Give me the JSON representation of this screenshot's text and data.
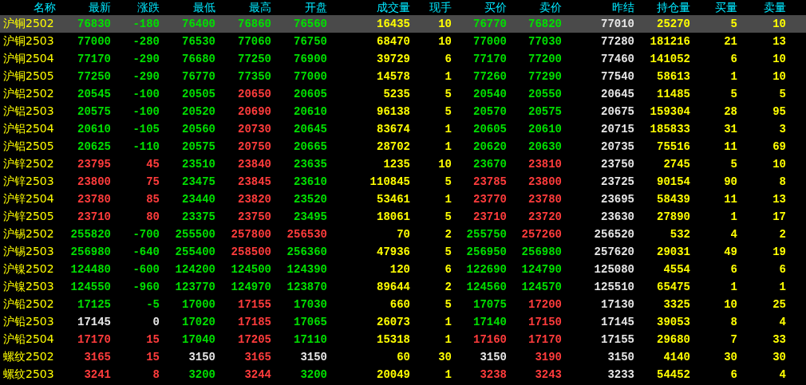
{
  "table": {
    "columns": [
      {
        "label": "名称",
        "kind": "name"
      },
      {
        "label": "最新",
        "kind": "price"
      },
      {
        "label": "涨跌",
        "kind": "price"
      },
      {
        "label": "最低",
        "kind": "price"
      },
      {
        "label": "最高",
        "kind": "price"
      },
      {
        "label": "开盘",
        "kind": "price"
      },
      {
        "label": "成交量",
        "kind": "volume"
      },
      {
        "label": "现手",
        "kind": "volume"
      },
      {
        "label": "买价",
        "kind": "price"
      },
      {
        "label": "卖价",
        "kind": "price"
      },
      {
        "label": "昨结",
        "kind": "reference"
      },
      {
        "label": "持仓量",
        "kind": "volume"
      },
      {
        "label": "买量",
        "kind": "volume"
      },
      {
        "label": "卖量",
        "kind": "volume"
      }
    ],
    "rows": [
      {
        "selected": true,
        "cells": [
          {
            "text": "沪铜2502"
          },
          {
            "text": "76830",
            "color": "#00e000"
          },
          {
            "text": "-180",
            "color": "#00e000"
          },
          {
            "text": "76400",
            "color": "#00e000"
          },
          {
            "text": "76860",
            "color": "#00e000"
          },
          {
            "text": "76560",
            "color": "#00e000"
          },
          {
            "text": "16435"
          },
          {
            "text": "10"
          },
          {
            "text": "76770",
            "color": "#00e000"
          },
          {
            "text": "76820",
            "color": "#00e000"
          },
          {
            "text": "77010"
          },
          {
            "text": "25270"
          },
          {
            "text": "5"
          },
          {
            "text": "10"
          }
        ]
      },
      {
        "selected": false,
        "cells": [
          {
            "text": "沪铜2503"
          },
          {
            "text": "77000",
            "color": "#00e000"
          },
          {
            "text": "-280",
            "color": "#00e000"
          },
          {
            "text": "76530",
            "color": "#00e000"
          },
          {
            "text": "77060",
            "color": "#00e000"
          },
          {
            "text": "76750",
            "color": "#00e000"
          },
          {
            "text": "68470"
          },
          {
            "text": "10"
          },
          {
            "text": "77000",
            "color": "#00e000"
          },
          {
            "text": "77030",
            "color": "#00e000"
          },
          {
            "text": "77280"
          },
          {
            "text": "181216"
          },
          {
            "text": "21"
          },
          {
            "text": "13"
          }
        ]
      },
      {
        "selected": false,
        "cells": [
          {
            "text": "沪铜2504"
          },
          {
            "text": "77170",
            "color": "#00e000"
          },
          {
            "text": "-290",
            "color": "#00e000"
          },
          {
            "text": "76680",
            "color": "#00e000"
          },
          {
            "text": "77250",
            "color": "#00e000"
          },
          {
            "text": "76900",
            "color": "#00e000"
          },
          {
            "text": "39729"
          },
          {
            "text": "6"
          },
          {
            "text": "77170",
            "color": "#00e000"
          },
          {
            "text": "77200",
            "color": "#00e000"
          },
          {
            "text": "77460"
          },
          {
            "text": "141052"
          },
          {
            "text": "6"
          },
          {
            "text": "10"
          }
        ]
      },
      {
        "selected": false,
        "cells": [
          {
            "text": "沪铜2505"
          },
          {
            "text": "77250",
            "color": "#00e000"
          },
          {
            "text": "-290",
            "color": "#00e000"
          },
          {
            "text": "76770",
            "color": "#00e000"
          },
          {
            "text": "77350",
            "color": "#00e000"
          },
          {
            "text": "77000",
            "color": "#00e000"
          },
          {
            "text": "14578"
          },
          {
            "text": "1"
          },
          {
            "text": "77260",
            "color": "#00e000"
          },
          {
            "text": "77290",
            "color": "#00e000"
          },
          {
            "text": "77540"
          },
          {
            "text": "58613"
          },
          {
            "text": "1"
          },
          {
            "text": "10"
          }
        ]
      },
      {
        "selected": false,
        "cells": [
          {
            "text": "沪铝2502"
          },
          {
            "text": "20545",
            "color": "#00e000"
          },
          {
            "text": "-100",
            "color": "#00e000"
          },
          {
            "text": "20505",
            "color": "#00e000"
          },
          {
            "text": "20650",
            "color": "#ff3c3c"
          },
          {
            "text": "20605",
            "color": "#00e000"
          },
          {
            "text": "5235"
          },
          {
            "text": "5"
          },
          {
            "text": "20540",
            "color": "#00e000"
          },
          {
            "text": "20550",
            "color": "#00e000"
          },
          {
            "text": "20645"
          },
          {
            "text": "11485"
          },
          {
            "text": "5"
          },
          {
            "text": "5"
          }
        ]
      },
      {
        "selected": false,
        "cells": [
          {
            "text": "沪铝2503"
          },
          {
            "text": "20575",
            "color": "#00e000"
          },
          {
            "text": "-100",
            "color": "#00e000"
          },
          {
            "text": "20520",
            "color": "#00e000"
          },
          {
            "text": "20690",
            "color": "#ff3c3c"
          },
          {
            "text": "20610",
            "color": "#00e000"
          },
          {
            "text": "96138"
          },
          {
            "text": "5"
          },
          {
            "text": "20570",
            "color": "#00e000"
          },
          {
            "text": "20575",
            "color": "#00e000"
          },
          {
            "text": "20675"
          },
          {
            "text": "159304"
          },
          {
            "text": "28"
          },
          {
            "text": "95"
          }
        ]
      },
      {
        "selected": false,
        "cells": [
          {
            "text": "沪铝2504"
          },
          {
            "text": "20610",
            "color": "#00e000"
          },
          {
            "text": "-105",
            "color": "#00e000"
          },
          {
            "text": "20560",
            "color": "#00e000"
          },
          {
            "text": "20730",
            "color": "#ff3c3c"
          },
          {
            "text": "20645",
            "color": "#00e000"
          },
          {
            "text": "83674"
          },
          {
            "text": "1"
          },
          {
            "text": "20605",
            "color": "#00e000"
          },
          {
            "text": "20610",
            "color": "#00e000"
          },
          {
            "text": "20715"
          },
          {
            "text": "185833"
          },
          {
            "text": "31"
          },
          {
            "text": "3"
          }
        ]
      },
      {
        "selected": false,
        "cells": [
          {
            "text": "沪铝2505"
          },
          {
            "text": "20625",
            "color": "#00e000"
          },
          {
            "text": "-110",
            "color": "#00e000"
          },
          {
            "text": "20575",
            "color": "#00e000"
          },
          {
            "text": "20750",
            "color": "#ff3c3c"
          },
          {
            "text": "20665",
            "color": "#00e000"
          },
          {
            "text": "28702"
          },
          {
            "text": "1"
          },
          {
            "text": "20620",
            "color": "#00e000"
          },
          {
            "text": "20630",
            "color": "#00e000"
          },
          {
            "text": "20735"
          },
          {
            "text": "75516"
          },
          {
            "text": "11"
          },
          {
            "text": "69"
          }
        ]
      },
      {
        "selected": false,
        "cells": [
          {
            "text": "沪锌2502"
          },
          {
            "text": "23795",
            "color": "#ff3c3c"
          },
          {
            "text": "45",
            "color": "#ff3c3c"
          },
          {
            "text": "23510",
            "color": "#00e000"
          },
          {
            "text": "23840",
            "color": "#ff3c3c"
          },
          {
            "text": "23635",
            "color": "#00e000"
          },
          {
            "text": "1235"
          },
          {
            "text": "10"
          },
          {
            "text": "23670",
            "color": "#00e000"
          },
          {
            "text": "23810",
            "color": "#ff3c3c"
          },
          {
            "text": "23750"
          },
          {
            "text": "2745"
          },
          {
            "text": "5"
          },
          {
            "text": "10"
          }
        ]
      },
      {
        "selected": false,
        "cells": [
          {
            "text": "沪锌2503"
          },
          {
            "text": "23800",
            "color": "#ff3c3c"
          },
          {
            "text": "75",
            "color": "#ff3c3c"
          },
          {
            "text": "23475",
            "color": "#00e000"
          },
          {
            "text": "23845",
            "color": "#ff3c3c"
          },
          {
            "text": "23610",
            "color": "#00e000"
          },
          {
            "text": "110845"
          },
          {
            "text": "5"
          },
          {
            "text": "23785",
            "color": "#ff3c3c"
          },
          {
            "text": "23800",
            "color": "#ff3c3c"
          },
          {
            "text": "23725"
          },
          {
            "text": "90154"
          },
          {
            "text": "90"
          },
          {
            "text": "8"
          }
        ]
      },
      {
        "selected": false,
        "cells": [
          {
            "text": "沪锌2504"
          },
          {
            "text": "23780",
            "color": "#ff3c3c"
          },
          {
            "text": "85",
            "color": "#ff3c3c"
          },
          {
            "text": "23440",
            "color": "#00e000"
          },
          {
            "text": "23820",
            "color": "#ff3c3c"
          },
          {
            "text": "23520",
            "color": "#00e000"
          },
          {
            "text": "53461"
          },
          {
            "text": "1"
          },
          {
            "text": "23770",
            "color": "#ff3c3c"
          },
          {
            "text": "23780",
            "color": "#ff3c3c"
          },
          {
            "text": "23695"
          },
          {
            "text": "58439"
          },
          {
            "text": "11"
          },
          {
            "text": "13"
          }
        ]
      },
      {
        "selected": false,
        "cells": [
          {
            "text": "沪锌2505"
          },
          {
            "text": "23710",
            "color": "#ff3c3c"
          },
          {
            "text": "80",
            "color": "#ff3c3c"
          },
          {
            "text": "23375",
            "color": "#00e000"
          },
          {
            "text": "23750",
            "color": "#ff3c3c"
          },
          {
            "text": "23495",
            "color": "#00e000"
          },
          {
            "text": "18061"
          },
          {
            "text": "5"
          },
          {
            "text": "23710",
            "color": "#ff3c3c"
          },
          {
            "text": "23720",
            "color": "#ff3c3c"
          },
          {
            "text": "23630"
          },
          {
            "text": "27890"
          },
          {
            "text": "1"
          },
          {
            "text": "17"
          }
        ]
      },
      {
        "selected": false,
        "cells": [
          {
            "text": "沪锡2502"
          },
          {
            "text": "255820",
            "color": "#00e000"
          },
          {
            "text": "-700",
            "color": "#00e000"
          },
          {
            "text": "255500",
            "color": "#00e000"
          },
          {
            "text": "257800",
            "color": "#ff3c3c"
          },
          {
            "text": "256530",
            "color": "#ff3c3c"
          },
          {
            "text": "70"
          },
          {
            "text": "2"
          },
          {
            "text": "255750",
            "color": "#00e000"
          },
          {
            "text": "257260",
            "color": "#ff3c3c"
          },
          {
            "text": "256520"
          },
          {
            "text": "532"
          },
          {
            "text": "4"
          },
          {
            "text": "2"
          }
        ]
      },
      {
        "selected": false,
        "cells": [
          {
            "text": "沪锡2503"
          },
          {
            "text": "256980",
            "color": "#00e000"
          },
          {
            "text": "-640",
            "color": "#00e000"
          },
          {
            "text": "255400",
            "color": "#00e000"
          },
          {
            "text": "258500",
            "color": "#ff3c3c"
          },
          {
            "text": "256360",
            "color": "#00e000"
          },
          {
            "text": "47936"
          },
          {
            "text": "5"
          },
          {
            "text": "256950",
            "color": "#00e000"
          },
          {
            "text": "256980",
            "color": "#00e000"
          },
          {
            "text": "257620"
          },
          {
            "text": "29031"
          },
          {
            "text": "49"
          },
          {
            "text": "19"
          }
        ]
      },
      {
        "selected": false,
        "cells": [
          {
            "text": "沪镍2502"
          },
          {
            "text": "124480",
            "color": "#00e000"
          },
          {
            "text": "-600",
            "color": "#00e000"
          },
          {
            "text": "124200",
            "color": "#00e000"
          },
          {
            "text": "124500",
            "color": "#00e000"
          },
          {
            "text": "124390",
            "color": "#00e000"
          },
          {
            "text": "120"
          },
          {
            "text": "6"
          },
          {
            "text": "122690",
            "color": "#00e000"
          },
          {
            "text": "124790",
            "color": "#00e000"
          },
          {
            "text": "125080"
          },
          {
            "text": "4554"
          },
          {
            "text": "6"
          },
          {
            "text": "6"
          }
        ]
      },
      {
        "selected": false,
        "cells": [
          {
            "text": "沪镍2503"
          },
          {
            "text": "124550",
            "color": "#00e000"
          },
          {
            "text": "-960",
            "color": "#00e000"
          },
          {
            "text": "123770",
            "color": "#00e000"
          },
          {
            "text": "124970",
            "color": "#00e000"
          },
          {
            "text": "123870",
            "color": "#00e000"
          },
          {
            "text": "89644"
          },
          {
            "text": "2"
          },
          {
            "text": "124560",
            "color": "#00e000"
          },
          {
            "text": "124570",
            "color": "#00e000"
          },
          {
            "text": "125510"
          },
          {
            "text": "65475"
          },
          {
            "text": "1"
          },
          {
            "text": "1"
          }
        ]
      },
      {
        "selected": false,
        "cells": [
          {
            "text": "沪铅2502"
          },
          {
            "text": "17125",
            "color": "#00e000"
          },
          {
            "text": "-5",
            "color": "#00e000"
          },
          {
            "text": "17000",
            "color": "#00e000"
          },
          {
            "text": "17155",
            "color": "#ff3c3c"
          },
          {
            "text": "17030",
            "color": "#00e000"
          },
          {
            "text": "660"
          },
          {
            "text": "5"
          },
          {
            "text": "17075",
            "color": "#00e000"
          },
          {
            "text": "17200",
            "color": "#ff3c3c"
          },
          {
            "text": "17130"
          },
          {
            "text": "3325"
          },
          {
            "text": "10"
          },
          {
            "text": "25"
          }
        ]
      },
      {
        "selected": false,
        "cells": [
          {
            "text": "沪铅2503"
          },
          {
            "text": "17145",
            "color": "#e6e6e6"
          },
          {
            "text": "0",
            "color": "#e6e6e6"
          },
          {
            "text": "17020",
            "color": "#00e000"
          },
          {
            "text": "17185",
            "color": "#ff3c3c"
          },
          {
            "text": "17065",
            "color": "#00e000"
          },
          {
            "text": "26073"
          },
          {
            "text": "1"
          },
          {
            "text": "17140",
            "color": "#00e000"
          },
          {
            "text": "17150",
            "color": "#ff3c3c"
          },
          {
            "text": "17145"
          },
          {
            "text": "39053"
          },
          {
            "text": "8"
          },
          {
            "text": "4"
          }
        ]
      },
      {
        "selected": false,
        "cells": [
          {
            "text": "沪铅2504"
          },
          {
            "text": "17170",
            "color": "#ff3c3c"
          },
          {
            "text": "15",
            "color": "#ff3c3c"
          },
          {
            "text": "17040",
            "color": "#00e000"
          },
          {
            "text": "17205",
            "color": "#ff3c3c"
          },
          {
            "text": "17110",
            "color": "#00e000"
          },
          {
            "text": "15318"
          },
          {
            "text": "1"
          },
          {
            "text": "17160",
            "color": "#ff3c3c"
          },
          {
            "text": "17170",
            "color": "#ff3c3c"
          },
          {
            "text": "17155"
          },
          {
            "text": "29680"
          },
          {
            "text": "7"
          },
          {
            "text": "33"
          }
        ]
      },
      {
        "selected": false,
        "cells": [
          {
            "text": "螺纹2502"
          },
          {
            "text": "3165",
            "color": "#ff3c3c"
          },
          {
            "text": "15",
            "color": "#ff3c3c"
          },
          {
            "text": "3150",
            "color": "#e6e6e6"
          },
          {
            "text": "3165",
            "color": "#ff3c3c"
          },
          {
            "text": "3150",
            "color": "#e6e6e6"
          },
          {
            "text": "60"
          },
          {
            "text": "30"
          },
          {
            "text": "3150",
            "color": "#e6e6e6"
          },
          {
            "text": "3190",
            "color": "#ff3c3c"
          },
          {
            "text": "3150"
          },
          {
            "text": "4140"
          },
          {
            "text": "30"
          },
          {
            "text": "30"
          }
        ]
      },
      {
        "selected": false,
        "cells": [
          {
            "text": "螺纹2503"
          },
          {
            "text": "3241",
            "color": "#ff3c3c"
          },
          {
            "text": "8",
            "color": "#ff3c3c"
          },
          {
            "text": "3200",
            "color": "#00e000"
          },
          {
            "text": "3244",
            "color": "#ff3c3c"
          },
          {
            "text": "3200",
            "color": "#00e000"
          },
          {
            "text": "20049"
          },
          {
            "text": "1"
          },
          {
            "text": "3238",
            "color": "#ff3c3c"
          },
          {
            "text": "3243",
            "color": "#ff3c3c"
          },
          {
            "text": "3233"
          },
          {
            "text": "54452"
          },
          {
            "text": "6"
          },
          {
            "text": "4"
          }
        ]
      }
    ]
  }
}
